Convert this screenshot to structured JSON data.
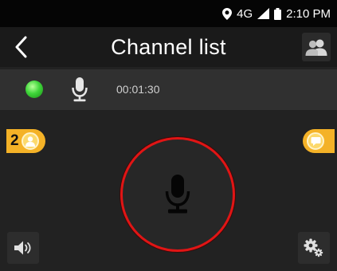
{
  "status_bar": {
    "network_label": "4G",
    "time": "2:10 PM",
    "icons": [
      "location-icon",
      "signal-icon",
      "battery-icon"
    ]
  },
  "header": {
    "title": "Channel list",
    "back_icon": "chevron-left-icon",
    "members_icon": "people-icon"
  },
  "talk_bar": {
    "status_icon": "green-dot-icon",
    "mic_icon": "microphone-icon",
    "timer": "00:01:30"
  },
  "main": {
    "user_count": "2",
    "user_icon": "user-icon",
    "message_icon": "message-icon",
    "ptt_icon": "microphone-icon",
    "speaker_icon": "speaker-icon",
    "settings_icon": "gears-icon"
  },
  "colors": {
    "accent": "#f4b227",
    "ptt_ring": "#e01515",
    "online": "#3fd63a",
    "background": "#222222"
  }
}
